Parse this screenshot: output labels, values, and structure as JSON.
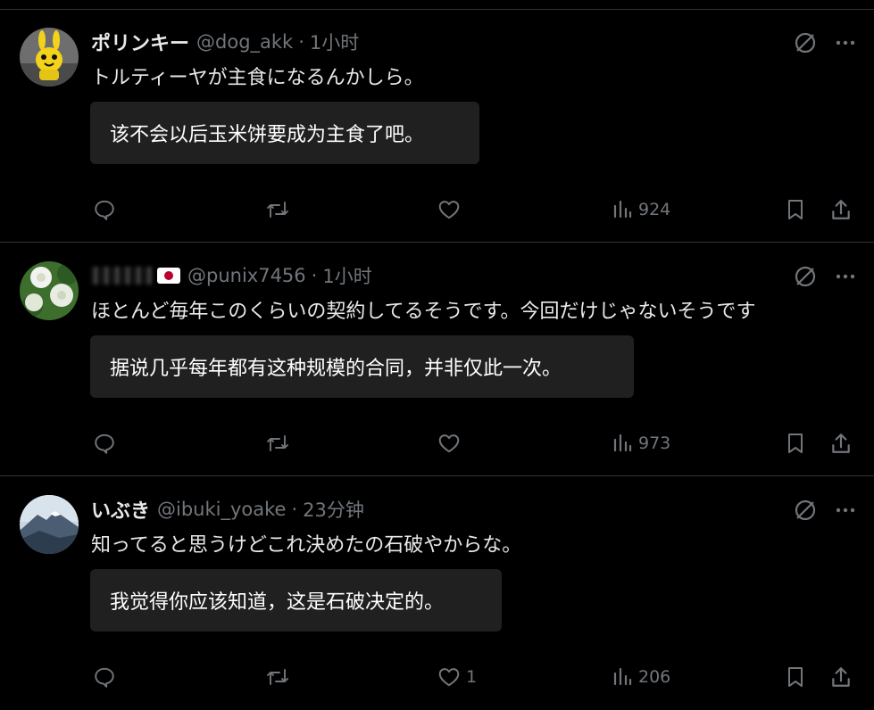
{
  "tweets": [
    {
      "name": "ポリンキー",
      "handle": "@dog_akk",
      "sep": "·",
      "time": "1小时",
      "text": "トルティーヤが主食になるんかしら。",
      "translation": "该不会以后玉米饼要成为主食了吧。",
      "likes": "",
      "views": "924"
    },
    {
      "name": "",
      "handle": "@punix7456",
      "sep": "·",
      "time": "1小时",
      "text": "ほとんど毎年このくらいの契約してるそうです。今回だけじゃないそうです",
      "translation": "据说几乎每年都有这种规模的合同，并非仅此一次。",
      "likes": "",
      "views": "973"
    },
    {
      "name": "いぶき",
      "handle": "@ibuki_yoake",
      "sep": "·",
      "time": "23分钟",
      "text": "知ってると思うけどこれ決めたの石破やからな。",
      "translation": "我觉得你应该知道，这是石破决定的。",
      "likes": "1",
      "views": "206"
    }
  ],
  "icons": {
    "grok": "grok-icon",
    "more": "more-icon",
    "reply": "reply-icon",
    "repost": "repost-icon",
    "like": "heart-icon",
    "views": "views-icon",
    "bookmark": "bookmark-icon",
    "share": "share-icon"
  },
  "colors": {
    "background": "#000000",
    "text": "#e7e9ea",
    "secondary": "#71767b",
    "translation_bg": "#202020",
    "border": "#2f3336"
  }
}
